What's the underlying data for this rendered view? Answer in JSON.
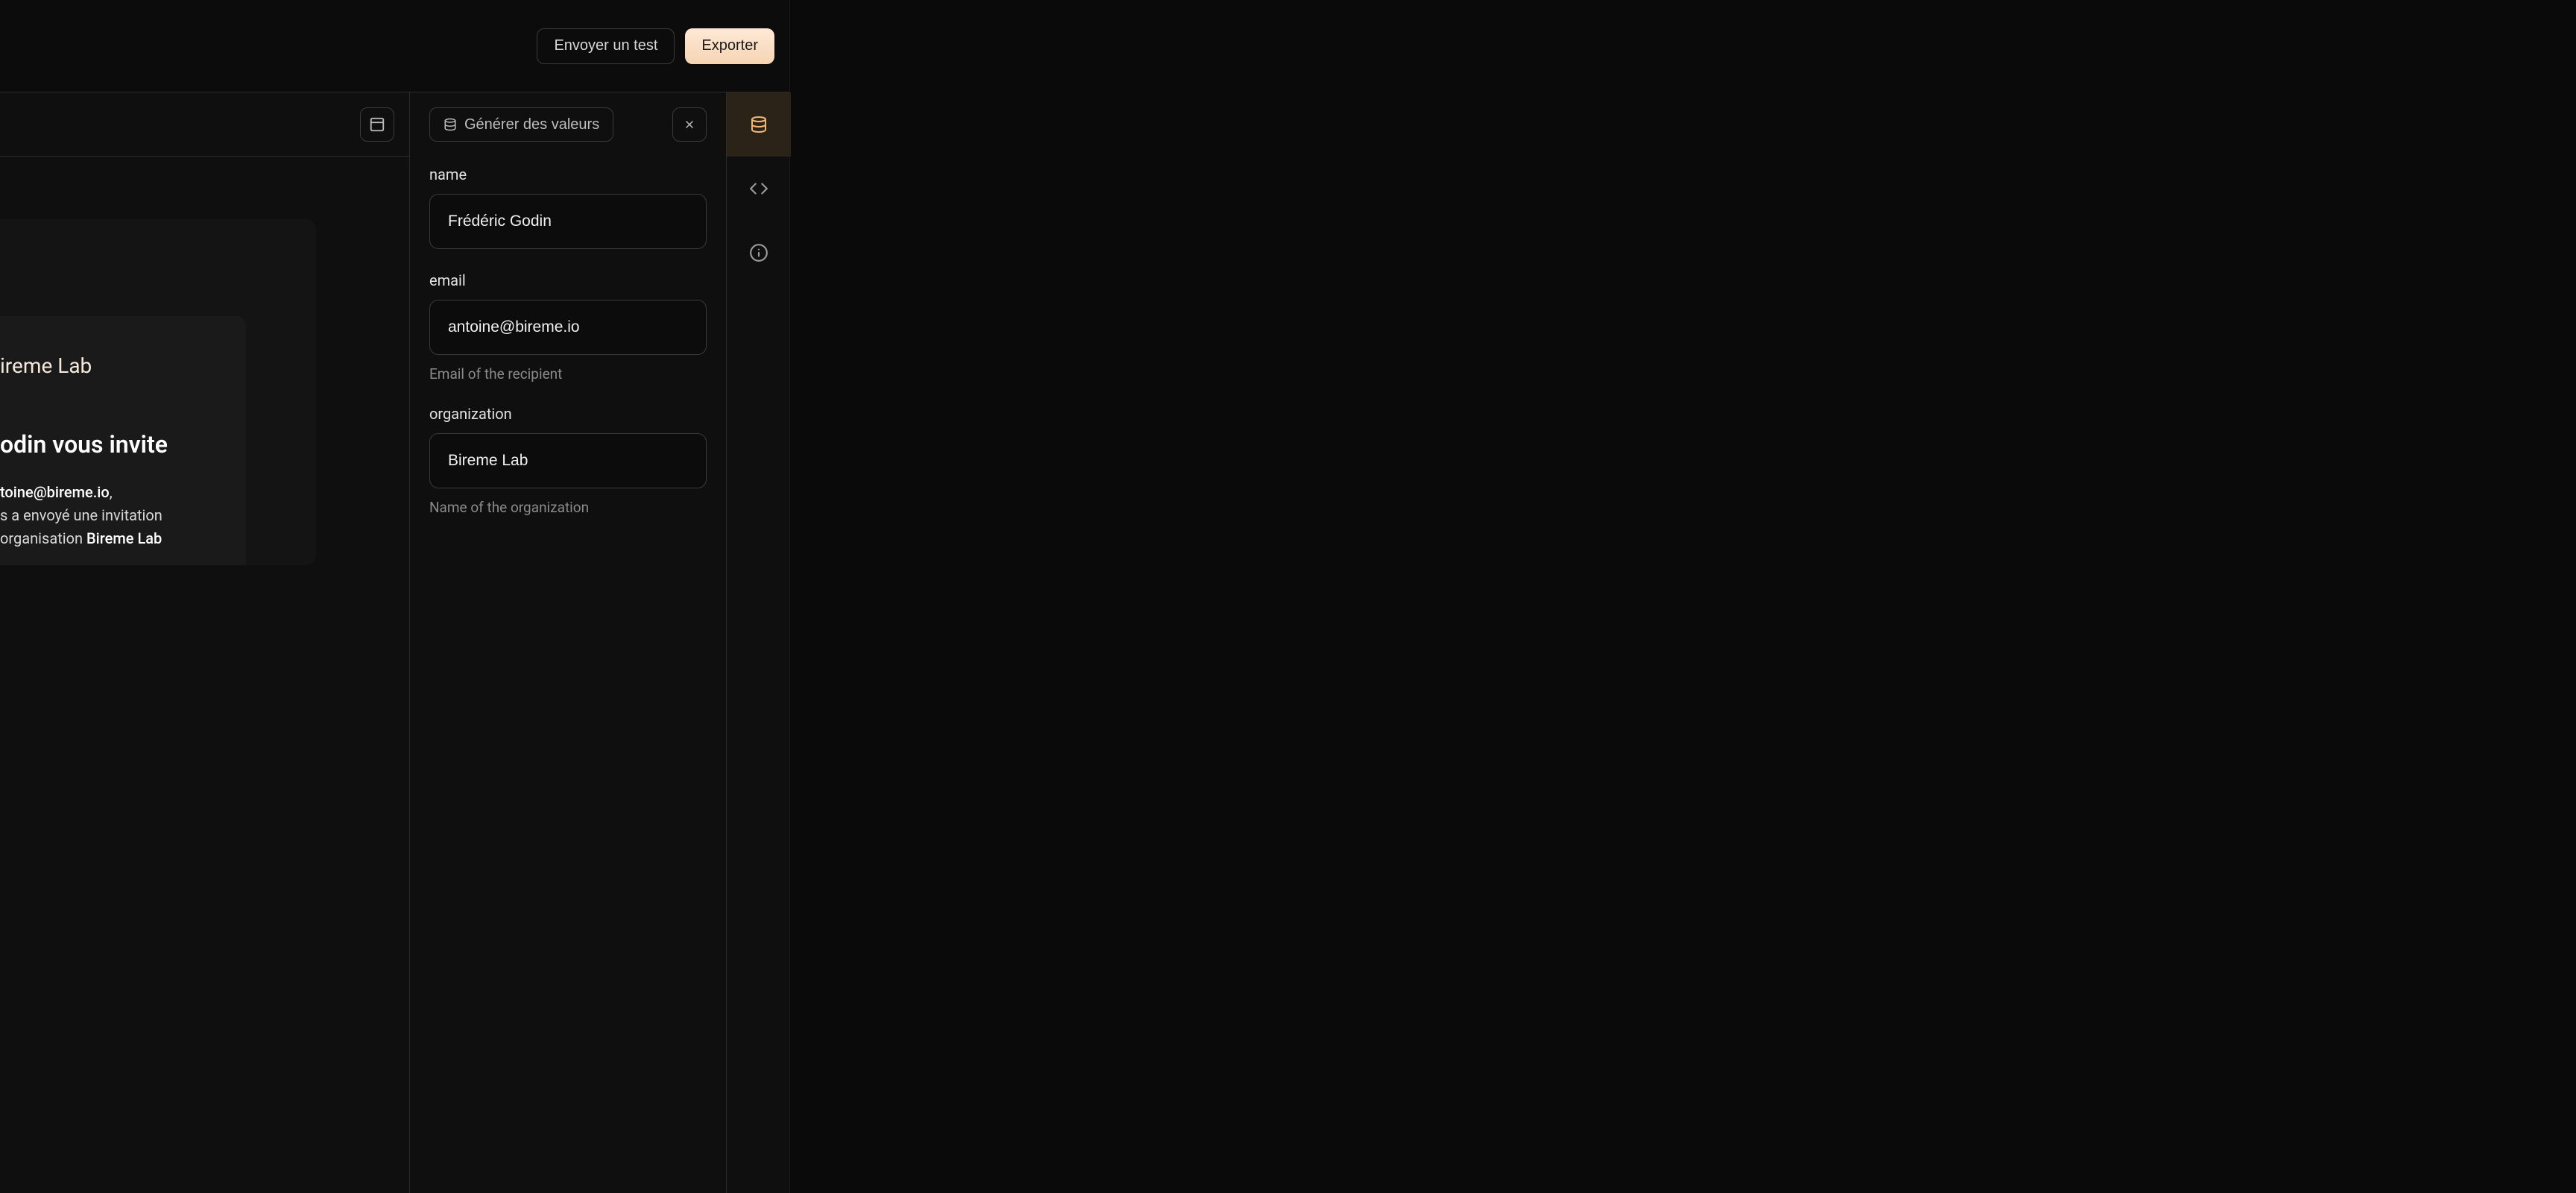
{
  "toolbar": {
    "send_test_label": "Envoyer un test",
    "export_label": "Exporter"
  },
  "panel": {
    "generate_label": "Générer des valeurs"
  },
  "fields": {
    "name": {
      "label": "name",
      "value": "Frédéric Godin"
    },
    "email": {
      "label": "email",
      "value": "antoine@bireme.io",
      "help": "Email of the recipient"
    },
    "organization": {
      "label": "organization",
      "value": "Bireme Lab",
      "help": "Name of the organization"
    }
  },
  "preview": {
    "brand_suffix": "ireme Lab",
    "headline_suffix": "odin vous invite",
    "body_line1_bold": "toine@bireme.io",
    "body_line1_tail": ",",
    "body_line2": "s a envoyé une invitation",
    "body_line3_prefix": "organisation ",
    "body_line3_bold": "Bireme Lab"
  }
}
